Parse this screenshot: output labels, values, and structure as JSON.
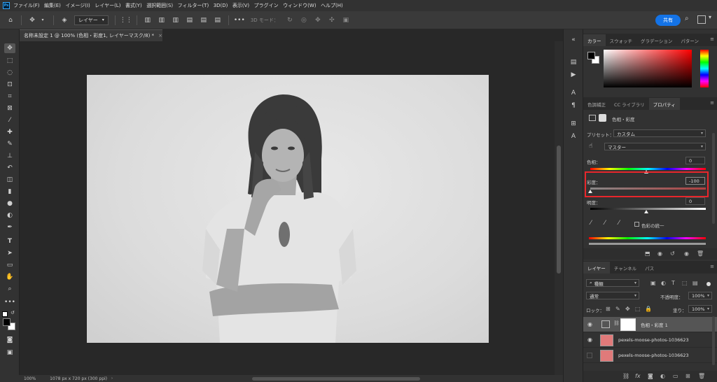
{
  "menubar": {
    "app_icon": "Ps",
    "items": [
      "ファイル(F)",
      "編集(E)",
      "イメージ(I)",
      "レイヤー(L)",
      "書式(Y)",
      "選択範囲(S)",
      "フィルター(T)",
      "3D(D)",
      "表示(V)",
      "プラグイン",
      "ウィンドウ(W)",
      "ヘルプ(H)"
    ]
  },
  "options": {
    "layer_select": "レイヤー",
    "mode_3d": "3D モード：",
    "share": "共有"
  },
  "document": {
    "tab_title": "名称未設定 1 @ 100% (色相・彩度1, レイヤーマスク/8) *",
    "close": "×"
  },
  "status": {
    "zoom": "100%",
    "info": "1078 px x 720 px (300 ppi)"
  },
  "color_panel": {
    "tabs": [
      "カラー",
      "スウォッチ",
      "グラデーション",
      "パターン"
    ],
    "menu": "≡"
  },
  "properties_panel": {
    "tabs": [
      "色調補正",
      "CC ライブラリ",
      "プロパティ"
    ],
    "header": "色相・彩度",
    "preset_label": "プリセット：",
    "preset_value": "カスタム",
    "channel_value": "マスター",
    "hue_label": "色相：",
    "hue_value": "0",
    "saturation_label": "彩度：",
    "saturation_value": "-100",
    "lightness_label": "明度：",
    "lightness_value": "0",
    "colorize_label": "色彩の統一"
  },
  "layers_panel": {
    "tabs": [
      "レイヤー",
      "チャンネル",
      "パス"
    ],
    "filter_label": "種類",
    "blend_mode": "通常",
    "opacity_label": "不透明度：",
    "opacity_value": "100%",
    "lock_label": "ロック：",
    "fill_label": "塗り：",
    "fill_value": "100%",
    "layers": [
      {
        "name": "色相・彩度 1",
        "visible": true
      },
      {
        "name": "pexels-moose-photos-1036623",
        "visible": true
      },
      {
        "name": "pexels-moose-photos-1036623",
        "visible": false
      }
    ]
  },
  "colors": {
    "accent": "#1473e6",
    "highlight": "#e8262b"
  }
}
